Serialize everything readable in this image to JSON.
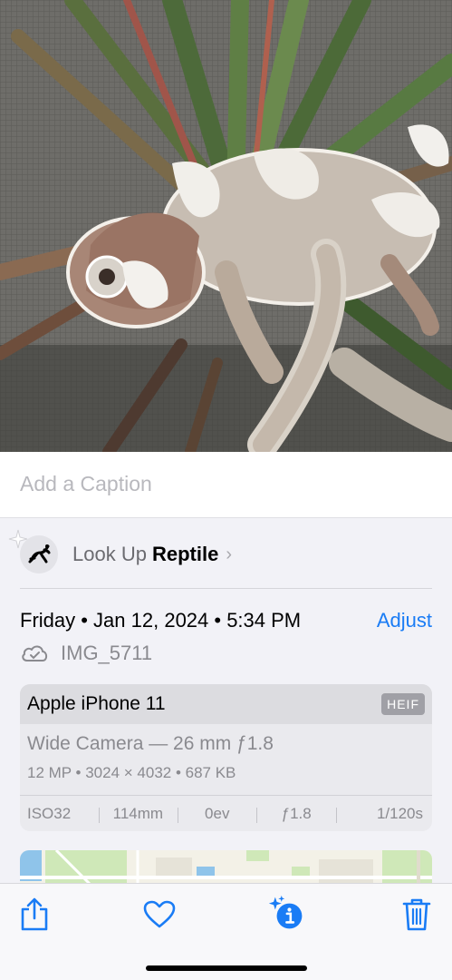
{
  "caption": {
    "placeholder": "Add a Caption"
  },
  "lookup": {
    "prefix": "Look Up",
    "subject": "Reptile",
    "chevron": "›",
    "icon": "gecko-icon"
  },
  "info": {
    "date": "Friday • Jan 12, 2024 • 5:34 PM",
    "adjust_label": "Adjust",
    "filename": "IMG_5711",
    "cloud_icon": "icloud-check-icon"
  },
  "camera": {
    "device": "Apple iPhone 11",
    "format": "HEIF",
    "lens": "Wide Camera — 26 mm ƒ1.8",
    "specs": "12 MP  •  3024 × 4032  •  687 KB",
    "exif": {
      "iso": "ISO32",
      "focal": "114mm",
      "ev": "0ev",
      "aperture": "ƒ1.8",
      "shutter": "1/120s"
    }
  },
  "toolbar": {
    "share": "share-icon",
    "favorite": "heart-icon",
    "info": "info-sparkle-icon",
    "delete": "trash-icon"
  },
  "colors": {
    "accent": "#1a7cf5",
    "background": "#f2f2f7",
    "card": "#eaeaee",
    "secondary_text": "#8a8a8f"
  }
}
